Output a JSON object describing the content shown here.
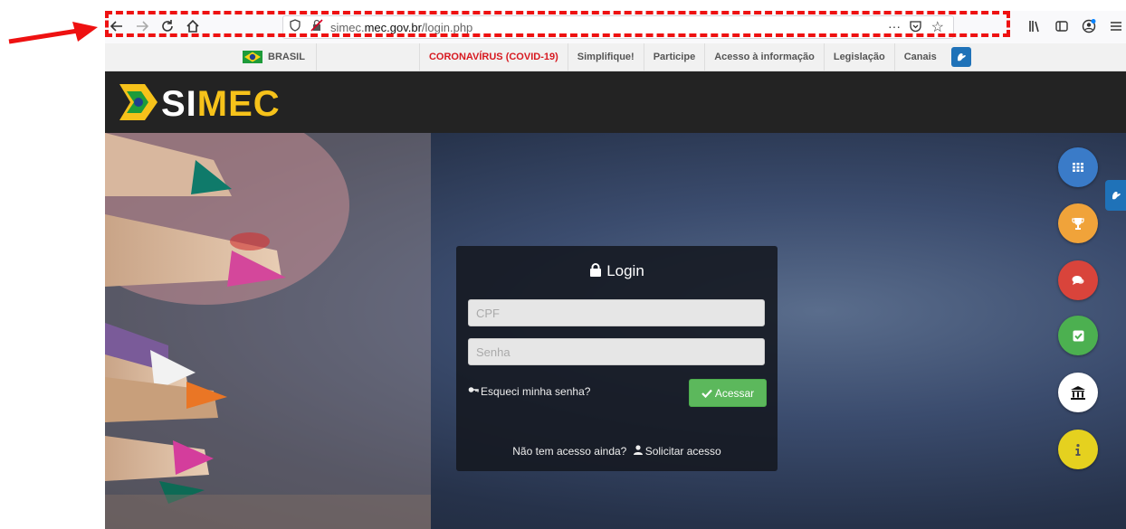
{
  "browser": {
    "url_host_pre": "simec.",
    "url_host": "mec.gov.br",
    "url_path": "/login.php",
    "icons": {
      "back": "back-arrow-icon",
      "forward": "forward-arrow-icon",
      "reload": "reload-icon",
      "home": "home-icon",
      "shield": "shield-icon",
      "insecure": "insecure-lock-icon",
      "more": "more-icon",
      "pocket": "pocket-icon",
      "bookmark": "star-icon",
      "library": "library-icon",
      "sidebar": "sidebar-icon",
      "account": "account-icon",
      "menu": "hamburger-menu-icon"
    },
    "more_glyph": "···"
  },
  "govbar": {
    "brasil": "BRASIL",
    "items": [
      {
        "label": "CORONAVÍRUS (COVID-19)",
        "color": "#d71920"
      },
      {
        "label": "Simplifique!"
      },
      {
        "label": "Participe"
      },
      {
        "label": "Acesso à informação"
      },
      {
        "label": "Legislação"
      },
      {
        "label": "Canais"
      }
    ]
  },
  "header": {
    "logo_si": "SI",
    "logo_mec": "MEC"
  },
  "login": {
    "title": "Login",
    "cpf_placeholder": "CPF",
    "senha_placeholder": "Senha",
    "forgot": "Esqueci minha senha?",
    "submit": "Acessar",
    "no_access": "Não tem acesso ainda?",
    "request": "Solicitar acesso"
  },
  "side_buttons": [
    {
      "name": "apps",
      "icon": "grid-icon",
      "color": "#3a7bc8"
    },
    {
      "name": "trophy",
      "icon": "trophy-icon",
      "color": "#f0a33a"
    },
    {
      "name": "chat",
      "icon": "chat-icon",
      "color": "#d9443b"
    },
    {
      "name": "check",
      "icon": "checkbox-icon",
      "color": "#4cb050"
    },
    {
      "name": "institution",
      "icon": "bank-icon",
      "color": "#ffffff"
    },
    {
      "name": "info",
      "icon": "info-icon",
      "color": "#e5d11f"
    }
  ],
  "colors": {
    "highlight": "#ee1111",
    "header_bg": "#232323",
    "logo_yellow": "#f6c21a",
    "accessibility_blue": "#1f72b8"
  }
}
